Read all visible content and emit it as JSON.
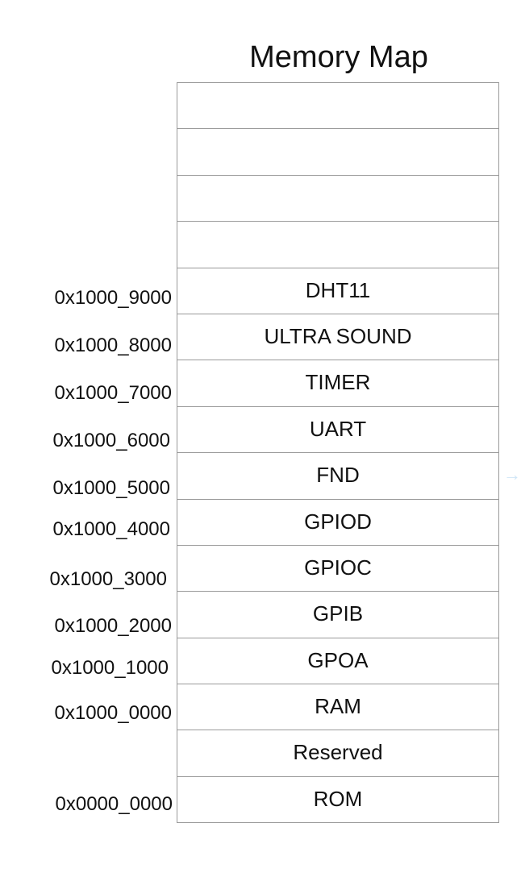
{
  "title": "Memory Map",
  "blocks": [
    "",
    "",
    "",
    "",
    "DHT11",
    "ULTRA SOUND",
    "TIMER",
    "UART",
    "FND",
    "GPIOD",
    "GPIOC",
    "GPIB",
    "GPOA",
    "RAM",
    "Reserved",
    "ROM"
  ],
  "addresses": [
    "0x1000_9000",
    "0x1000_8000",
    "0x1000_7000",
    "0x1000_6000",
    "0x1000_5000",
    "0x1000_4000",
    "0x1000_3000",
    "0x1000_2000",
    "0x1000_1000",
    "0x1000_0000",
    "0x0000_0000"
  ],
  "colors": {
    "border": "#9a9a9a",
    "text": "#111111",
    "faint_arrow": "#cfe6f7"
  },
  "icons": {
    "edge_arrow": "right-arrow-icon"
  }
}
